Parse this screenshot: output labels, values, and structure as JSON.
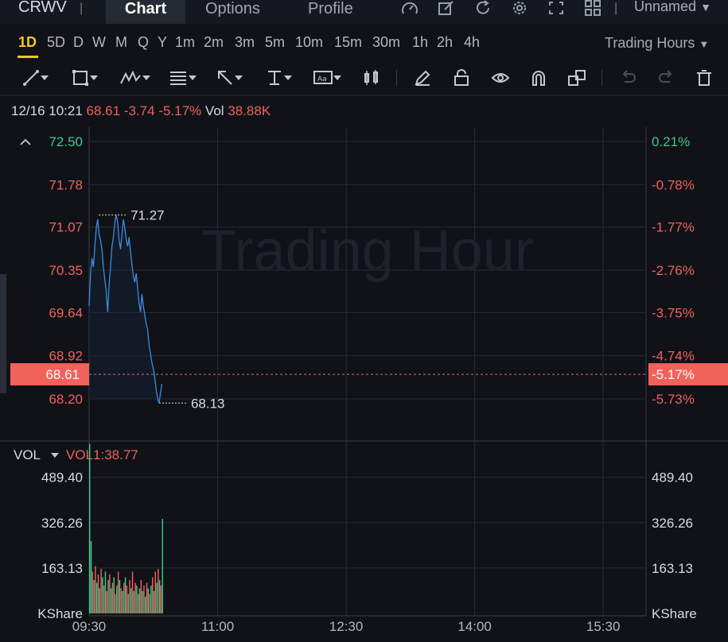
{
  "header": {
    "symbol": "CRWV",
    "tabs": [
      {
        "label": "Chart",
        "active": true
      },
      {
        "label": "Options",
        "active": false
      },
      {
        "label": "Profile",
        "active": false
      }
    ],
    "icons": [
      "gauge-icon",
      "edit-icon",
      "refresh-icon",
      "gear-icon",
      "fullscreen-icon",
      "grid-icon"
    ],
    "layout_name": "Unnamed"
  },
  "periods": {
    "items": [
      "1D",
      "5D",
      "D",
      "W",
      "M",
      "Q",
      "Y",
      "1m",
      "2m",
      "3m",
      "5m",
      "10m",
      "15m",
      "30m",
      "1h",
      "2h",
      "4h"
    ],
    "active": "1D",
    "session": "Trading Hours"
  },
  "toolbar": {
    "tools": [
      "trend-line-icon",
      "rectangle-icon",
      "wave-icon",
      "fibonacci-icon",
      "arrow-icon",
      "measure-icon",
      "text-icon",
      "candle-icon",
      "pencil-icon",
      "lock-icon",
      "eye-icon",
      "magnet-icon",
      "copy-icon",
      "undo-icon",
      "redo-icon",
      "trash-icon"
    ]
  },
  "quote": {
    "datetime": "12/16 10:21",
    "price": "68.61",
    "change": "-3.74",
    "change_pct": "-5.17%",
    "vol_label": "Vol",
    "volume": "38.88K"
  },
  "watermark": "Trading Hour",
  "colors": {
    "background": "#101218",
    "up": "#3ec98a",
    "down": "#f0625a",
    "line": "#3d8be0",
    "accent": "#f4c430"
  },
  "chart_data": {
    "type": "line",
    "title": "",
    "price_axis_left": [
      "72.50",
      "71.78",
      "71.07",
      "70.35",
      "69.64",
      "68.92",
      "68.20"
    ],
    "price_axis_right": [
      "0.21%",
      "-0.78%",
      "-1.77%",
      "-2.76%",
      "-3.75%",
      "-4.74%",
      "-5.73%"
    ],
    "current_price": "68.61",
    "current_pct": "-5.17%",
    "ylim": [
      68.2,
      72.5
    ],
    "x_ticks": [
      "09:30",
      "11:00",
      "12:30",
      "14:00",
      "15:30"
    ],
    "x_tick_minutes": [
      0,
      90,
      180,
      270,
      360
    ],
    "x_range_minutes": [
      0,
      390
    ],
    "high_label": "71.27",
    "low_label": "68.13",
    "high_value": 71.27,
    "low_value": 68.13,
    "series": [
      {
        "minute": [
          0,
          1,
          2,
          3,
          4,
          5,
          6,
          7,
          8,
          9,
          10,
          11,
          12,
          13,
          14,
          15,
          16,
          17,
          18,
          19,
          20,
          21,
          22,
          23,
          24,
          25,
          26,
          27,
          28,
          29,
          30,
          31,
          32,
          33,
          34,
          35,
          36,
          37,
          38,
          39,
          40,
          41,
          42,
          43,
          44,
          45,
          46,
          47,
          48,
          49,
          50,
          51
        ],
        "values": [
          69.75,
          70.3,
          70.55,
          70.4,
          70.75,
          71.05,
          71.2,
          70.95,
          70.85,
          70.7,
          70.4,
          70.2,
          70.0,
          69.65,
          70.1,
          70.4,
          70.75,
          70.9,
          71.15,
          71.27,
          71.15,
          70.85,
          70.7,
          70.95,
          71.2,
          71.05,
          70.85,
          70.75,
          70.9,
          70.65,
          70.45,
          70.25,
          70.15,
          70.3,
          70.05,
          69.8,
          69.65,
          69.95,
          69.75,
          69.6,
          69.45,
          69.35,
          69.1,
          68.95,
          68.8,
          68.7,
          68.55,
          68.35,
          68.2,
          68.13,
          68.3,
          68.45
        ]
      }
    ],
    "volume": {
      "label": "VOL",
      "indicator": "VOL1:38.77",
      "axis": [
        "489.40",
        "326.26",
        "163.13",
        "KShare"
      ],
      "ylim": [
        0,
        620
      ],
      "bars": [
        {
          "v": 610,
          "up": true
        },
        {
          "v": 260,
          "up": true
        },
        {
          "v": 150,
          "up": false
        },
        {
          "v": 120,
          "up": true
        },
        {
          "v": 170,
          "up": false
        },
        {
          "v": 110,
          "up": true
        },
        {
          "v": 140,
          "up": false
        },
        {
          "v": 90,
          "up": true
        },
        {
          "v": 160,
          "up": false
        },
        {
          "v": 130,
          "up": true
        },
        {
          "v": 100,
          "up": false
        },
        {
          "v": 150,
          "up": true
        },
        {
          "v": 80,
          "up": false
        },
        {
          "v": 120,
          "up": true
        },
        {
          "v": 140,
          "up": false
        },
        {
          "v": 90,
          "up": true
        },
        {
          "v": 110,
          "up": false
        },
        {
          "v": 130,
          "up": true
        },
        {
          "v": 70,
          "up": false
        },
        {
          "v": 100,
          "up": true
        },
        {
          "v": 150,
          "up": false
        },
        {
          "v": 120,
          "up": true
        },
        {
          "v": 90,
          "up": false
        },
        {
          "v": 80,
          "up": true
        },
        {
          "v": 110,
          "up": false
        },
        {
          "v": 130,
          "up": true
        },
        {
          "v": 100,
          "up": false
        },
        {
          "v": 70,
          "up": true
        },
        {
          "v": 120,
          "up": false
        },
        {
          "v": 90,
          "up": true
        },
        {
          "v": 150,
          "up": false
        },
        {
          "v": 80,
          "up": true
        },
        {
          "v": 110,
          "up": false
        },
        {
          "v": 100,
          "up": true
        },
        {
          "v": 70,
          "up": false
        },
        {
          "v": 90,
          "up": true
        },
        {
          "v": 120,
          "up": false
        },
        {
          "v": 80,
          "up": true
        },
        {
          "v": 100,
          "up": false
        },
        {
          "v": 60,
          "up": true
        },
        {
          "v": 110,
          "up": false
        },
        {
          "v": 90,
          "up": true
        },
        {
          "v": 70,
          "up": false
        },
        {
          "v": 100,
          "up": true
        },
        {
          "v": 130,
          "up": false
        },
        {
          "v": 80,
          "up": true
        },
        {
          "v": 150,
          "up": false
        },
        {
          "v": 110,
          "up": true
        },
        {
          "v": 160,
          "up": false
        },
        {
          "v": 120,
          "up": true
        },
        {
          "v": 100,
          "up": false
        },
        {
          "v": 340,
          "up": true
        }
      ]
    }
  }
}
